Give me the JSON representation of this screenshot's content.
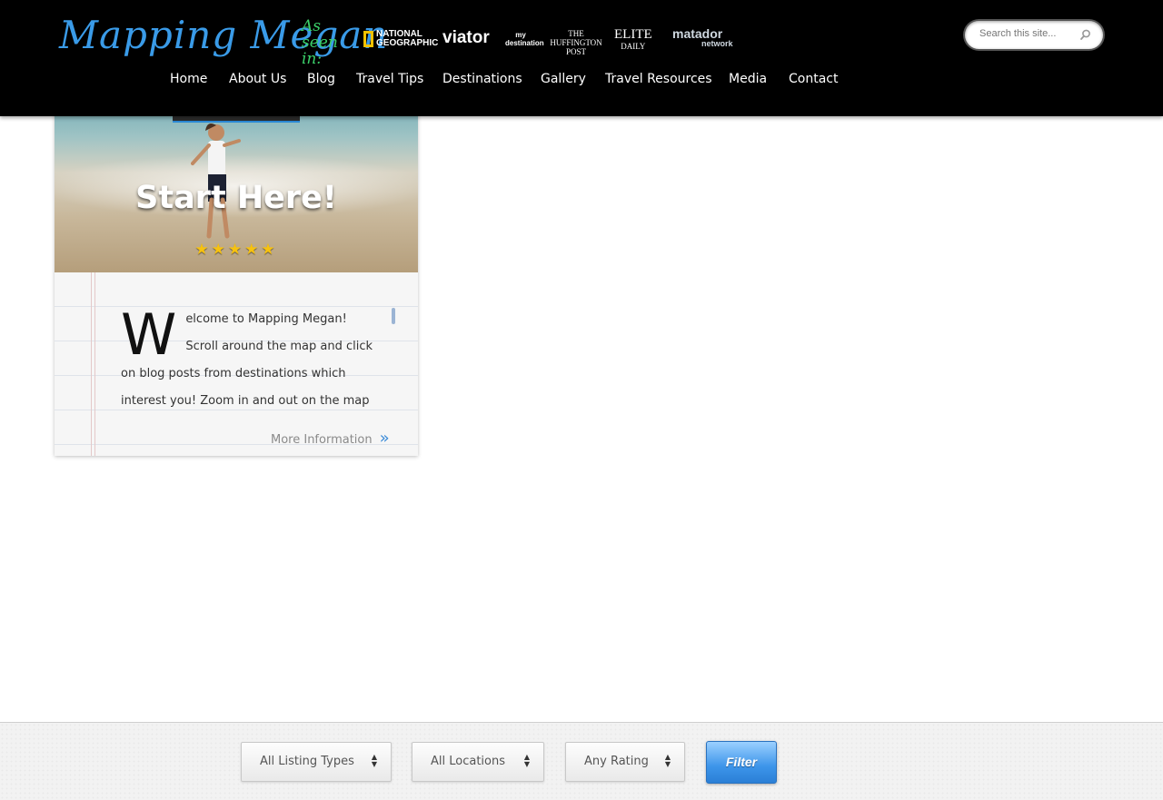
{
  "header": {
    "logo": "Mapping Megan",
    "as_seen_in": "As seen in:",
    "press": {
      "national_geographic": "NATIONAL GEOGRAPHIC",
      "viator": "viator",
      "my_destination": "my destination",
      "huffington": "THE HUFFINGTON POST",
      "elite": "ELITE",
      "elite_sub": "DAILY",
      "matador": "matador",
      "matador_sub": "network"
    },
    "search_placeholder": "Search this site...",
    "nav": [
      "Home",
      "About Us",
      "Blog",
      "Travel Tips",
      "Destinations",
      "Gallery",
      "Travel Resources",
      "Media",
      "Contact"
    ]
  },
  "listing": {
    "title": "Start Here!",
    "rating": 5,
    "stars": "★★★★★",
    "dropcap": "W",
    "description": "elcome to Mapping Megan! Scroll around the map and click on blog posts from destinations which interest you! Zoom in and out on the map",
    "more_label": "More Information",
    "more_arrow": "»"
  },
  "filters": {
    "listing_type": "All Listing Types",
    "location": "All Locations",
    "rating": "Any Rating",
    "filter_label": "Filter"
  },
  "colors": {
    "header_bg": "#000000",
    "logo": "#3a9be8",
    "accent": "#3d95ea"
  }
}
